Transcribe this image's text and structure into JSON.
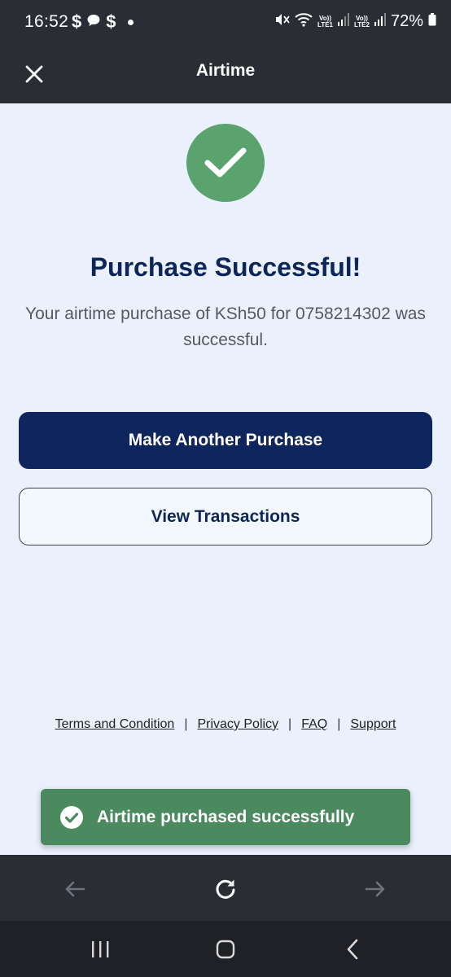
{
  "status_bar": {
    "time": "16:52",
    "notif_icons": [
      "dollar-icon",
      "chat-bubble-icon",
      "dollar-icon",
      "dot-icon"
    ],
    "battery": "72%",
    "sim1_label": "LTE1",
    "sim2_label": "LTE2",
    "volte_label": "Vo))"
  },
  "app_bar": {
    "title": "Airtime"
  },
  "result": {
    "heading": "Purchase Successful!",
    "message": "Your airtime purchase of KSh50 for 0758214302 was successful."
  },
  "actions": {
    "primary_label": "Make Another Purchase",
    "secondary_label": "View Transactions"
  },
  "footer": {
    "links": [
      "Terms and Condition",
      "Privacy Policy",
      "FAQ",
      "Support"
    ],
    "separator": "|"
  },
  "toast": {
    "text": "Airtime purchased successfully"
  },
  "colors": {
    "header_bg": "#2a2d34",
    "page_bg": "#eaf1fc",
    "primary": "#0f255d",
    "success": "#5aa36f",
    "toast_bg": "#4b8a5e"
  }
}
